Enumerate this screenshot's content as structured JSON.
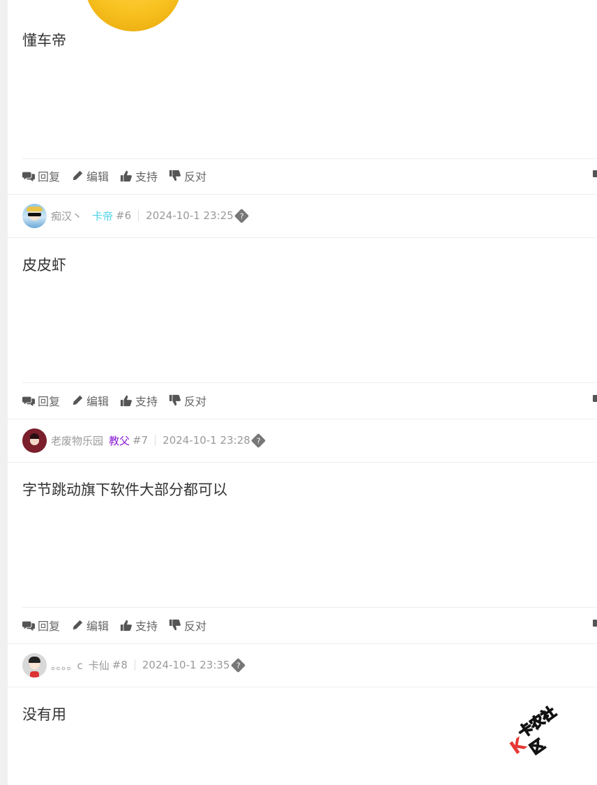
{
  "posts": [
    {
      "content": "懂车帝"
    },
    {
      "author": "痴汉丶",
      "group": "卡帝",
      "group_color": "#4fd3e8",
      "floor": "#6",
      "time": "2024-10-1 23:25",
      "content": "皮皮虾"
    },
    {
      "author": "老废物乐园",
      "group": "教父",
      "group_color": "#8a1ad6",
      "floor": "#7",
      "time": "2024-10-1 23:28",
      "content": "字节跳动旗下软件大部分都可以"
    },
    {
      "author": "。。。。c",
      "group": "卡仙",
      "group_color": "#999999",
      "floor": "#8",
      "time": "2024-10-1 23:35",
      "content": "没有用"
    }
  ],
  "actions": {
    "reply": "回复",
    "edit": "编辑",
    "support": "支持",
    "oppose": "反对"
  },
  "watermark": {
    "mark": "K",
    "text": "卡农社区"
  },
  "colors": {
    "text": "#333333",
    "meta": "#999999",
    "divider": "#eeeeee",
    "watermark_red": "#e53935"
  },
  "icons": {
    "reply": "comments-icon",
    "edit": "pencil-icon",
    "support": "thumbs-up-icon",
    "oppose": "thumbs-down-icon",
    "status": "unknown-glyph-icon"
  }
}
